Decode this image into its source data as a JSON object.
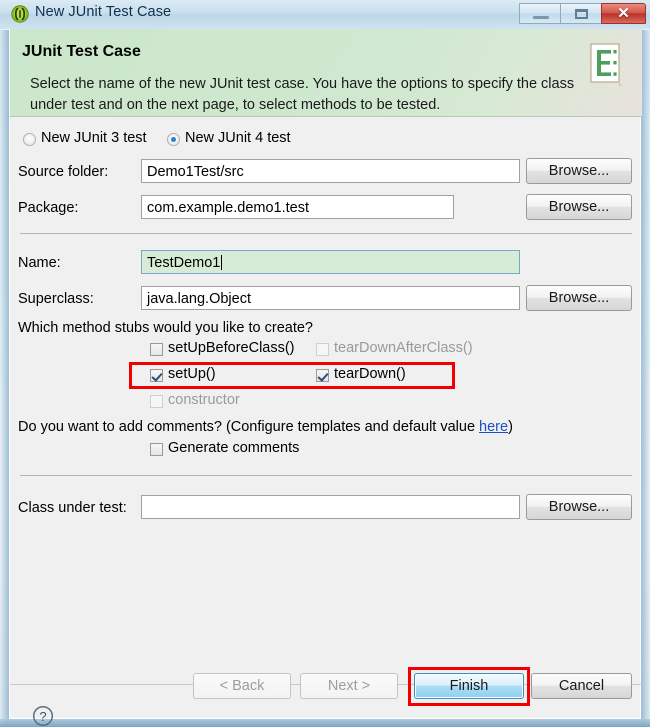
{
  "window": {
    "title": "New JUnit Test Case",
    "icon": "junit-icon",
    "controls": {
      "minimize": "minimize-button",
      "maximize": "maximize-button",
      "close_label": "✕"
    }
  },
  "banner": {
    "title": "JUnit Test Case",
    "description": "Select the name of the new JUnit test case. You have the options to specify the class under test and on the next page, to select methods to be tested.",
    "icon": "junit-wizard-page-icon",
    "bg_color": "#cbe7cb"
  },
  "version_choice": {
    "options": [
      {
        "label": "New JUnit 3 test",
        "selected": false
      },
      {
        "label": "New JUnit 4 test",
        "selected": true
      }
    ]
  },
  "fields": {
    "source_folder": {
      "label": "Source folder:",
      "value": "Demo1Test/src",
      "browse_label": "Browse..."
    },
    "package": {
      "label": "Package:",
      "value": "com.example.demo1.test",
      "browse_label": "Browse..."
    },
    "name": {
      "label": "Name:",
      "value": "TestDemo1",
      "focused": true
    },
    "superclass": {
      "label": "Superclass:",
      "value": "java.lang.Object",
      "browse_label": "Browse..."
    },
    "class_under_test": {
      "label": "Class under test:",
      "value": "",
      "browse_label": "Browse..."
    }
  },
  "method_stubs": {
    "question": "Which method stubs would you like to create?",
    "items": [
      {
        "label": "setUpBeforeClass()",
        "checked": false,
        "disabled": false
      },
      {
        "label": "tearDownAfterClass()",
        "checked": false,
        "disabled": true
      },
      {
        "label": "setUp()",
        "checked": true,
        "disabled": false
      },
      {
        "label": "tearDown()",
        "checked": true,
        "disabled": false
      },
      {
        "label": "constructor",
        "checked": false,
        "disabled": true
      }
    ]
  },
  "comments": {
    "question_before": "Do you want to add comments? (Configure templates and default value ",
    "link_text": "here",
    "question_after": ")",
    "checkbox_label": "Generate comments",
    "checked": false
  },
  "buttons": {
    "help": "help-button",
    "back": {
      "label": "< Back",
      "disabled": true
    },
    "next": {
      "label": "Next >",
      "disabled": true
    },
    "finish": {
      "label": "Finish",
      "default": true
    },
    "cancel": {
      "label": "Cancel",
      "disabled": false
    }
  },
  "annotations": {
    "color": "#f20000",
    "regions": [
      "method-stubs-setup-teardown-row",
      "finish-button"
    ]
  }
}
